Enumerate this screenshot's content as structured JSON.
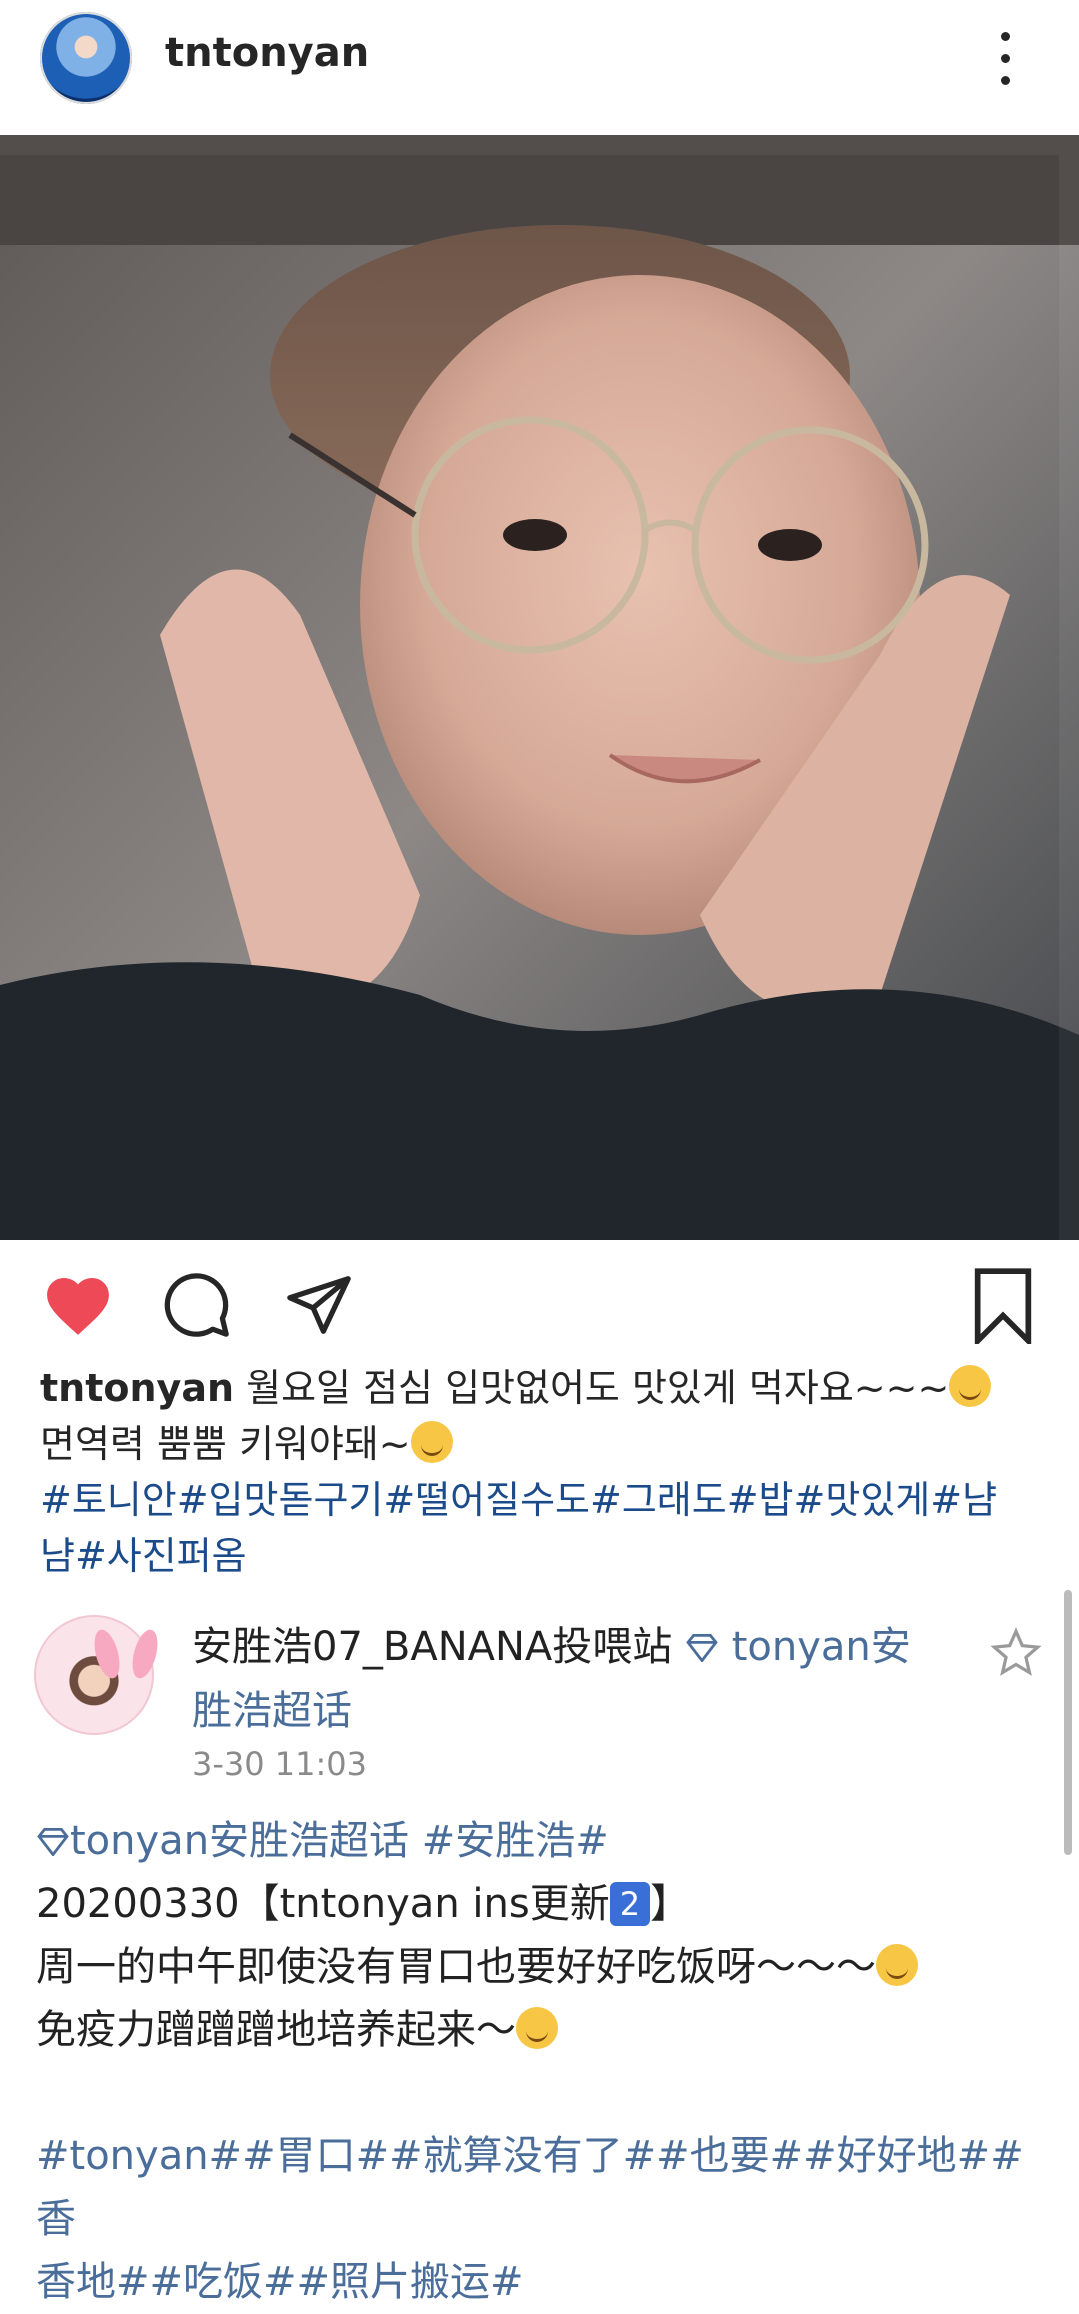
{
  "header": {
    "username": "tntonyan",
    "avatar_icon": "profile-avatar",
    "more_icon": "more-vertical-icon"
  },
  "post": {
    "image_icon": "portrait-photo"
  },
  "actions": {
    "like_icon": "heart-filled-icon",
    "like_color": "#ed4956",
    "comment_icon": "comment-bubble-icon",
    "share_icon": "paper-plane-icon",
    "save_icon": "bookmark-icon"
  },
  "caption": {
    "username": "tntonyan",
    "line1": "월요일 점심 입맛없어도 맛있게 먹자요~~~",
    "line2": "면역력 뿜뿜 키워야돼~",
    "tags_line1": "#토니안#입맛돋구기#떨어질수도#그래도#밥#맛있게#냠",
    "tags_line2": "냠#사진퍼옴"
  },
  "weibo": {
    "author": "安胜浩07_BANANA投喂站",
    "super_topic_line1": "tonyan安",
    "super_topic_line2": "胜浩超话",
    "time": "3-30 11:03",
    "topic_line": "tonyan安胜浩超话 #安胜浩#",
    "title_prefix": "20200330【tntonyan ins更新",
    "title_badge": "2",
    "title_suffix": "】",
    "body_line1": " 周一的中午即使没有胃口也要好好吃饭呀～～～",
    "body_line2": "免疫力蹭蹭蹭地培养起来～",
    "hashtags_line1": "#tonyan##胃口##就算没有了##也要##好好地##香",
    "hashtags_line2": "香地##吃饭##照片搬运#",
    "star_icon": "star-outline-icon"
  },
  "colors": {
    "text": "#262626",
    "hashtag": "#1b4b8a",
    "topic": "#4a6d9a",
    "muted": "#8a8a8a"
  }
}
